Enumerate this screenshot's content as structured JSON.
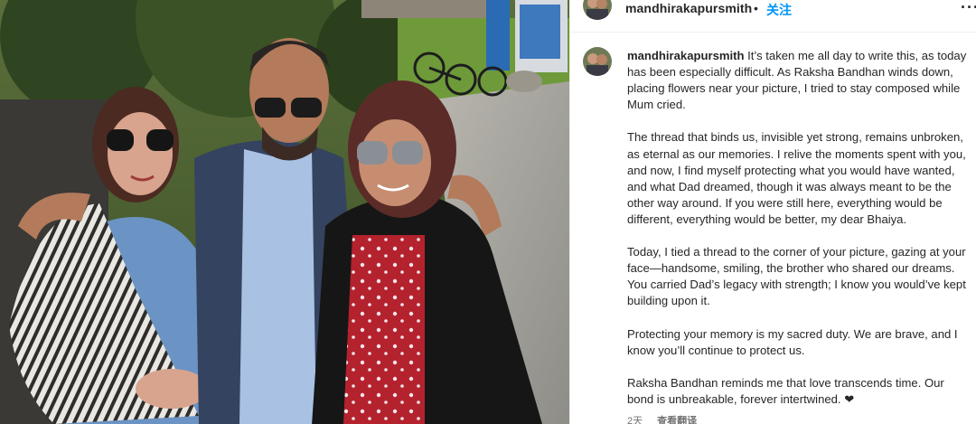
{
  "post": {
    "username": "mandhirakapursmith",
    "dot": "•",
    "follow_label": "关注",
    "more_icon": "more-horizontal-icon"
  },
  "caption": {
    "username": "mandhirakapursmith",
    "paragraphs": [
      "It’s taken me all day to write this, as today has been especially difficult. As Raksha Bandhan winds down, placing flowers near your picture, I tried to stay composed while Mum cried.",
      "The thread that binds us, invisible yet strong, remains unbroken, as eternal as our memories. I relive the moments spent with you, and now, I find myself protecting what you would have wanted, and what Dad dreamed, though it was always meant to be the other way around. If you were still here, everything would be different, everything would be better, my dear Bhaiya.",
      "Today, I tied a thread to the corner of your picture, gazing at your face—handsome, smiling, the brother who shared our dreams. You carried Dad’s legacy with strength; I know you would’ve kept building upon it.",
      "Protecting your memory is my sacred duty. We are brave, and I know you’ll continue to protect us.",
      "Raksha Bandhan reminds me that love transcends time. Our bond is unbreakable, forever intertwined. ❤"
    ]
  },
  "meta": {
    "time": "2天",
    "translate_label": "查看翻译"
  },
  "colors": {
    "link": "#0095f6",
    "text": "#262626",
    "muted": "#737373"
  }
}
